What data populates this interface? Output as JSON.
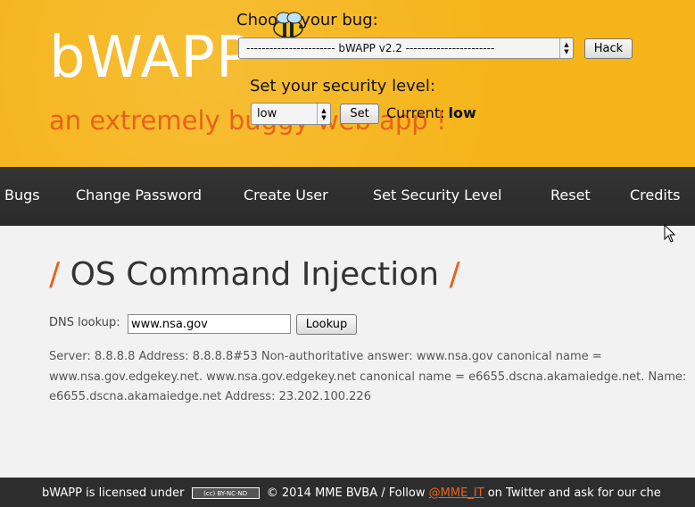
{
  "header": {
    "logo": "bWAPP",
    "tagline": "an extremely buggy web app !",
    "choose_label": "Choose your bug:",
    "bug_selected": "----------------------- bWAPP v2.2 -----------------------",
    "hack_label": "Hack",
    "security_label": "Set your security level:",
    "security_selected": "low",
    "set_label": "Set",
    "current_label": "Current:",
    "current_value": "low"
  },
  "menu": {
    "items": [
      {
        "label": "Bugs"
      },
      {
        "label": "Change Password"
      },
      {
        "label": "Create User"
      },
      {
        "label": "Set Security Level"
      },
      {
        "label": "Reset"
      },
      {
        "label": "Credits"
      }
    ]
  },
  "main": {
    "title": "OS Command Injection",
    "slash": "/",
    "dns_label": "DNS lookup:",
    "dns_value": "www.nsa.gov",
    "lookup_label": "Lookup",
    "output_line1": "Server: 8.8.8.8 Address: 8.8.8.8#53 Non-authoritative answer: www.nsa.gov canonical name =",
    "output_line2": "www.nsa.gov.edgekey.net. www.nsa.gov.edgekey.net canonical name = e6655.dscna.akamaiedge.net. Name:",
    "output_line3": "e6655.dscna.akamaiedge.net Address: 23.202.100.226"
  },
  "footer": {
    "text_before": "bWAPP is licensed under",
    "cc_badge": "(cc) BY-NC-ND",
    "text_mid": "© 2014 MME BVBA / Follow",
    "twitter": "@MME_IT",
    "text_after": "on Twitter and ask for our che"
  },
  "colors": {
    "header_bg": "#f5b419",
    "accent": "#e8621a",
    "menu_bg": "#2d2d2d"
  }
}
